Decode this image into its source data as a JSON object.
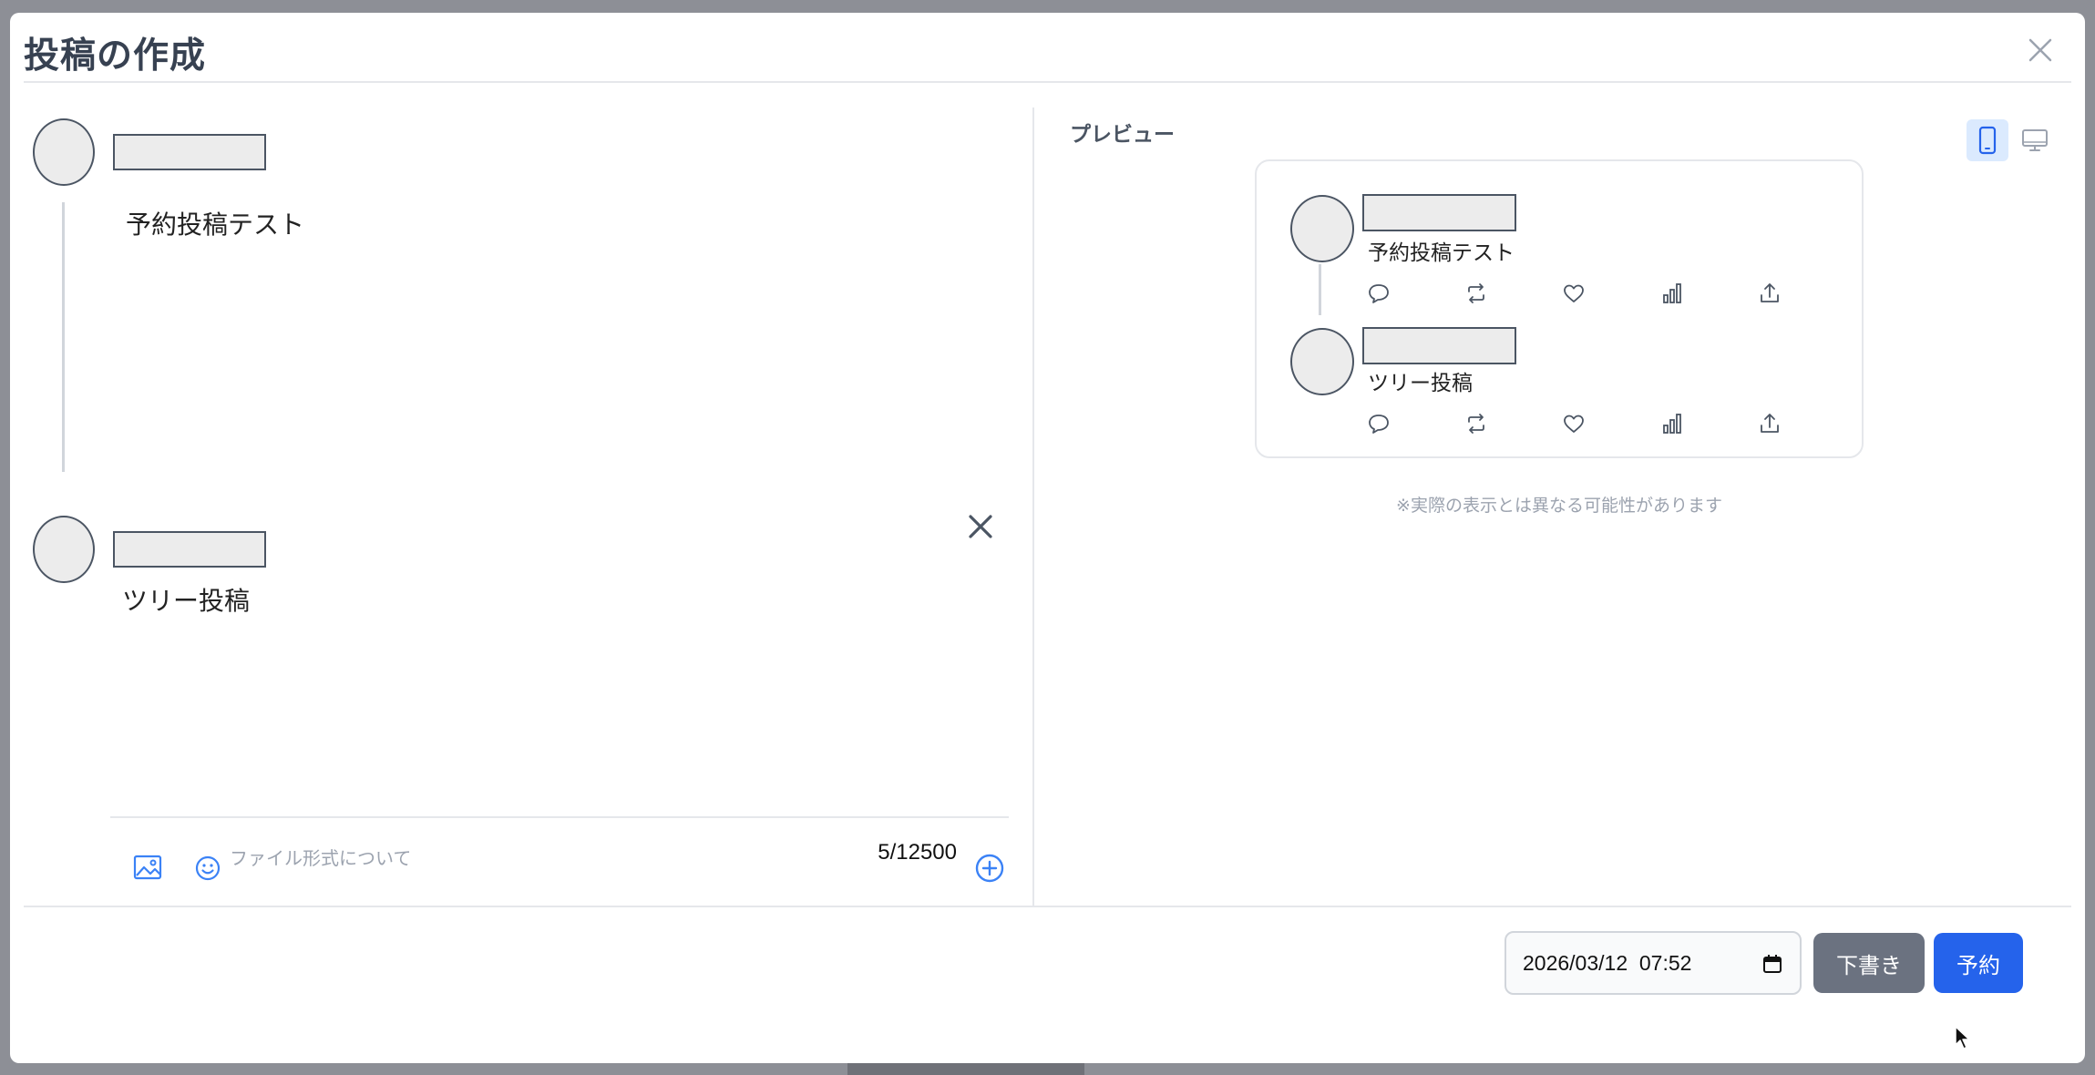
{
  "modal": {
    "title": "投稿の作成",
    "close_icon": "close-icon"
  },
  "editor": {
    "posts": [
      {
        "text": "予約投稿テスト"
      },
      {
        "text": "ツリー投稿"
      }
    ],
    "toolbar": {
      "image_icon": "image-icon",
      "emoji_icon": "emoji-icon",
      "file_format_link": "ファイル形式について",
      "char_count": "5/12500",
      "add_icon": "add-post-icon"
    }
  },
  "preview": {
    "label": "プレビュー",
    "device": "mobile",
    "posts": [
      {
        "text": "予約投稿テスト"
      },
      {
        "text": "ツリー投稿"
      }
    ],
    "actions": [
      "reply-icon",
      "repost-icon",
      "like-icon",
      "stats-icon",
      "share-icon"
    ],
    "note": "※実際の表示とは異なる可能性があります"
  },
  "footer": {
    "datetime_value": "2026/03/12  07:52",
    "draft_label": "下書き",
    "schedule_label": "予約"
  },
  "colors": {
    "primary": "#2563eb",
    "secondary": "#6b7280",
    "accent_icon": "#3b82f6"
  }
}
